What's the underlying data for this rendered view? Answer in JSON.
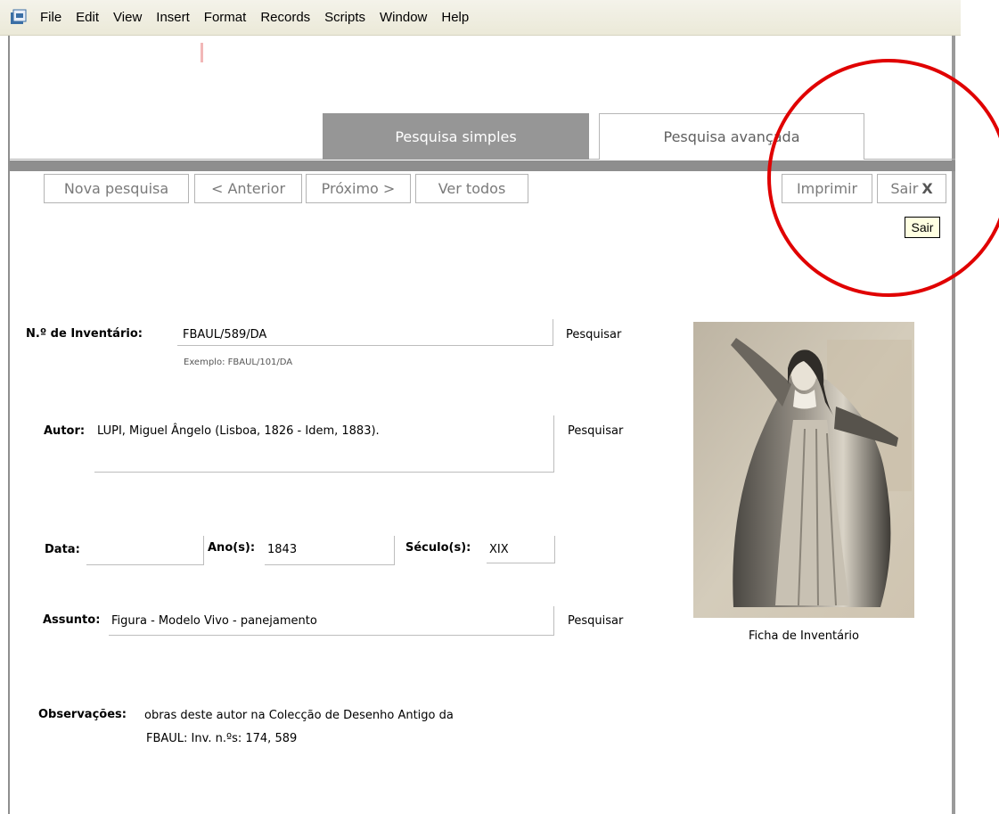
{
  "menu": [
    "File",
    "Edit",
    "View",
    "Insert",
    "Format",
    "Records",
    "Scripts",
    "Window",
    "Help"
  ],
  "tabs": {
    "simple": "Pesquisa simples",
    "advanced": "Pesquisa avançada"
  },
  "nav": {
    "new_search": "Nova pesquisa",
    "previous": "< Anterior",
    "next": "Próximo >",
    "view_all": "Ver todos",
    "print": "Imprimir",
    "exit": "Sair",
    "exit_mark": "X"
  },
  "tooltip": "Sair",
  "form": {
    "inventory_label": "N.º de Inventário",
    "inventory_value": "FBAUL/589/DA",
    "inventory_hint": "Exemplo: FBAUL/101/DA",
    "author_label": "Autor",
    "author_value": "LUPI, Miguel Ângelo (Lisboa, 1826 - Idem, 1883).",
    "date_label": "Data",
    "date_value": "",
    "year_label": "Ano(s)",
    "year_value": "1843",
    "century_label": "Século(s)",
    "century_value": "XIX",
    "subject_label": "Assunto",
    "subject_value": "Figura - Modelo Vivo - panejamento",
    "notes_label": "Observações",
    "notes_line1": "obras deste autor na Colecção de Desenho Antigo da",
    "notes_line2": "FBAUL:  Inv. n.ºs: 174, 589",
    "search": "Pesquisar"
  },
  "caption": "Ficha de Inventário",
  "colors": {
    "active_tab": "#969696",
    "annotation": "#e00000",
    "tooltip_bg": "#ffffe1"
  }
}
